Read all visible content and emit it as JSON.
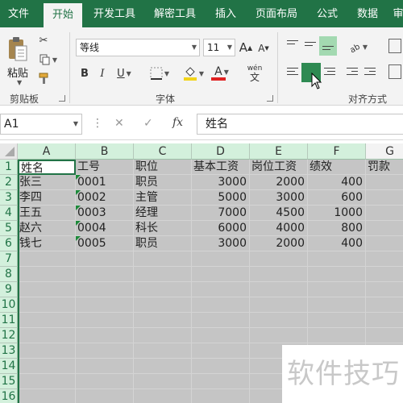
{
  "tabs": [
    "文件",
    "开始",
    "开发工具",
    "解密工具",
    "插入",
    "页面布局",
    "公式",
    "数据",
    "审"
  ],
  "active_tab": "开始",
  "clipboard": {
    "paste_label": "粘贴",
    "group_label": "剪贴板"
  },
  "font": {
    "name": "等线",
    "size": "11",
    "grow": "A",
    "shrink": "A",
    "bold": "B",
    "italic": "I",
    "underline": "U",
    "font_color_letter": "A",
    "phonetic": "wén",
    "phonetic_char": "文",
    "group_label": "字体",
    "fill_color": "#f2d41a",
    "font_color": "#e02222"
  },
  "alignment": {
    "group_label": "对齐方式"
  },
  "formula_bar": {
    "cell_ref": "A1",
    "content": "姓名",
    "fx": "fx",
    "cancel": "✕",
    "enter": "✓"
  },
  "columns": [
    "A",
    "B",
    "C",
    "D",
    "E",
    "F",
    "G"
  ],
  "rows": [
    "1",
    "2",
    "3",
    "4",
    "5",
    "6",
    "7",
    "8",
    "9",
    "10",
    "11",
    "12",
    "13",
    "14",
    "15",
    "16"
  ],
  "table": {
    "headers": [
      "姓名",
      "工号",
      "职位",
      "基本工资",
      "岗位工资",
      "绩效",
      "罚款"
    ],
    "data": [
      [
        "张三",
        "0001",
        "职员",
        "3000",
        "2000",
        "400"
      ],
      [
        "李四",
        "0002",
        "主管",
        "5000",
        "3000",
        "600"
      ],
      [
        "王五",
        "0003",
        "经理",
        "7000",
        "4500",
        "1000"
      ],
      [
        "赵六",
        "0004",
        "科长",
        "6000",
        "4000",
        "800"
      ],
      [
        "钱七",
        "0005",
        "职员",
        "3000",
        "2000",
        "400"
      ]
    ]
  },
  "watermark": "软件技巧",
  "colors": {
    "ribbon_green": "#217346",
    "header_green": "#d3f0dc",
    "selection_gray": "#c5c5c5"
  }
}
